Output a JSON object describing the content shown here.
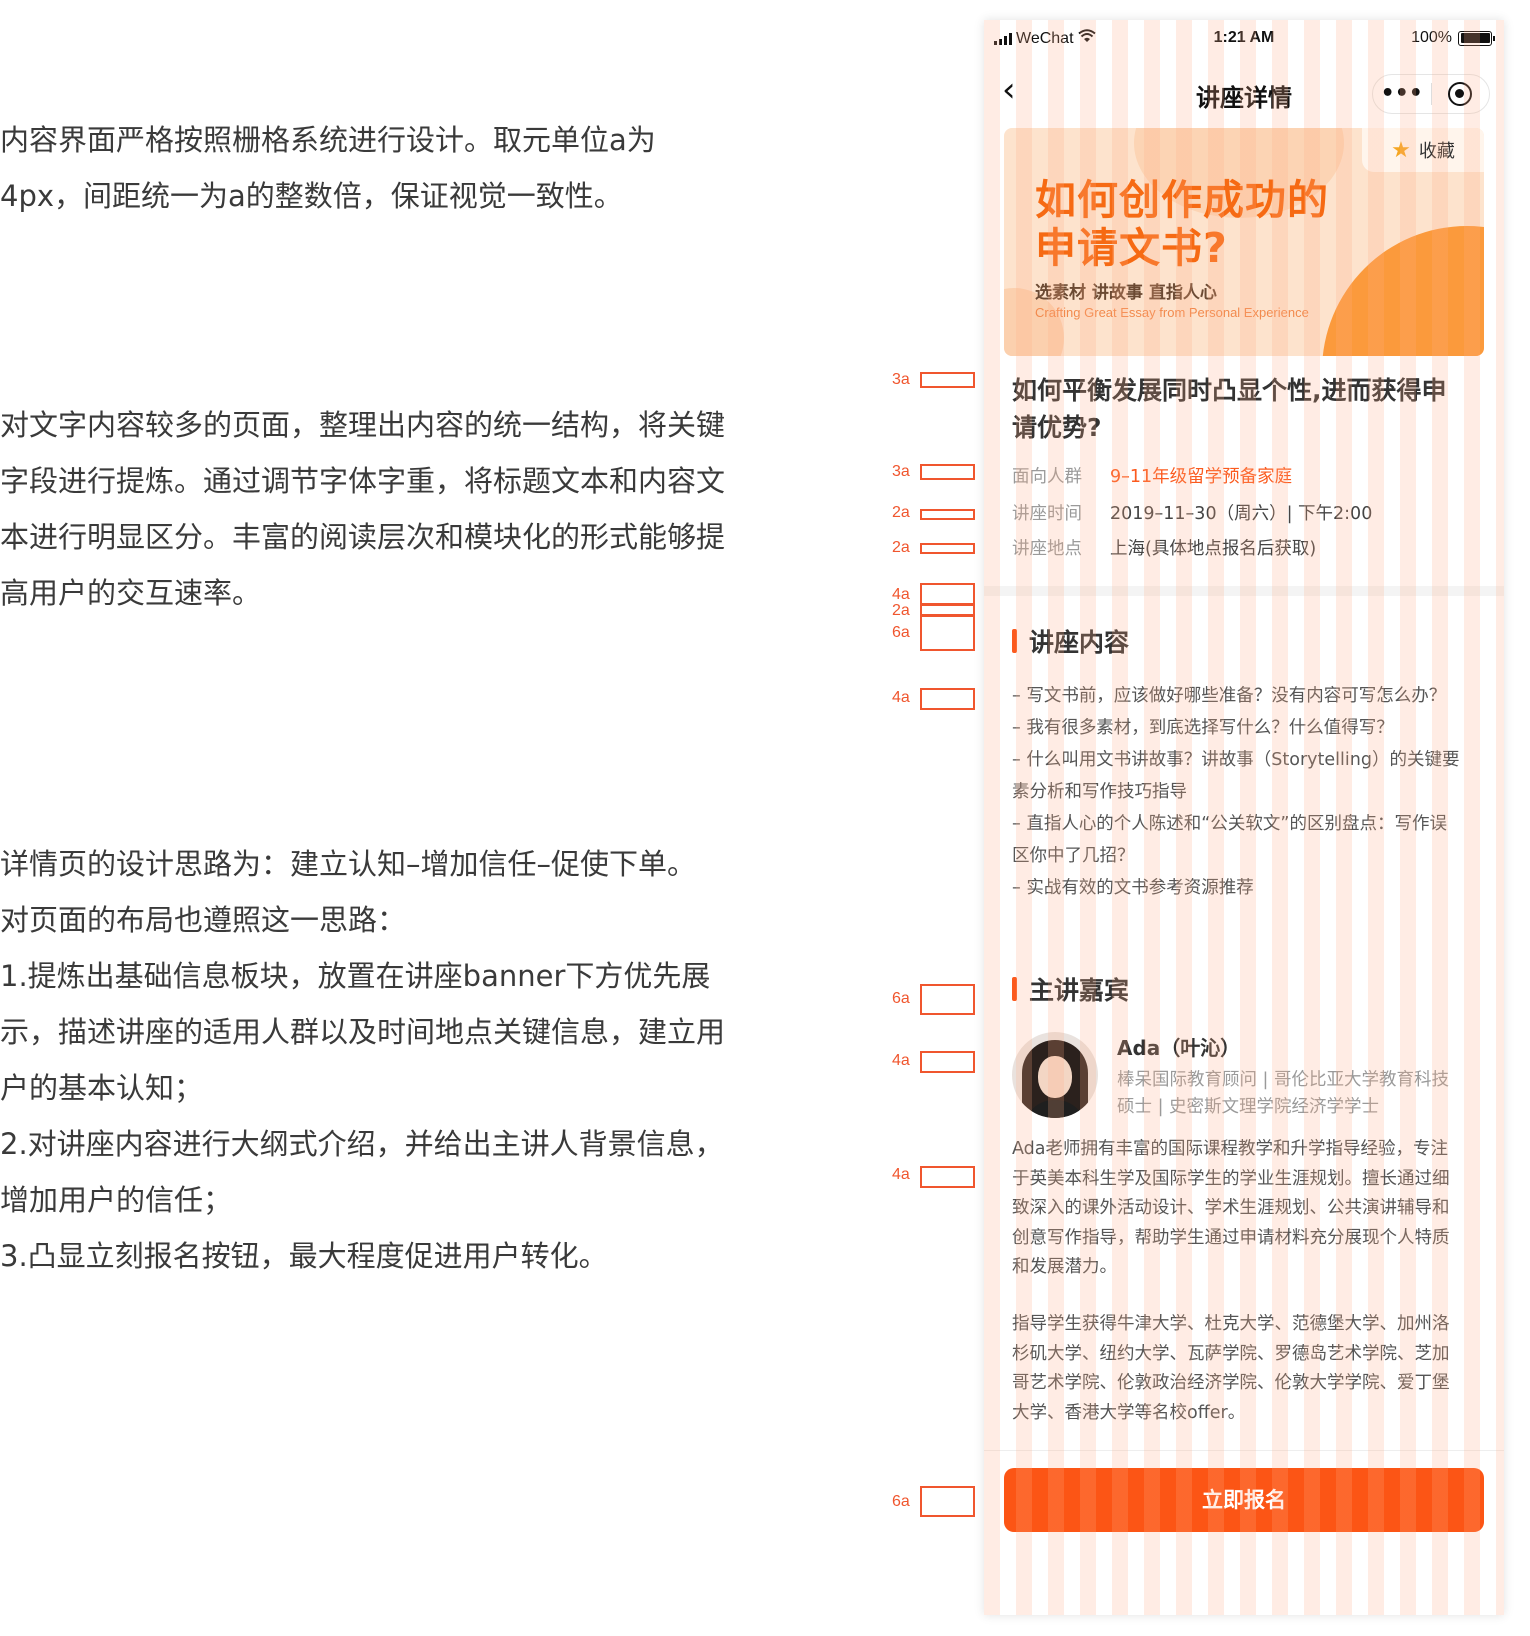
{
  "explanation": {
    "p1": [
      "内容界面严格按照栅格系统进行设计。取元单位a为",
      "4px，间距统一为a的整数倍，保证视觉一致性。"
    ],
    "p2": [
      "对文字内容较多的页面，整理出内容的统一结构，将关键",
      "字段进行提炼。通过调节字体字重，将标题文本和内容文",
      "本进行明显区分。丰富的阅读层次和模块化的形式能够提",
      "高用户的交互速率。"
    ],
    "p3": [
      "详情页的设计思路为：建立认知–增加信任–促使下单。",
      "对页面的布局也遵照这一思路：",
      "1.提炼出基础信息板块，放置在讲座banner下方优先展",
      "示，描述讲座的适用人群以及时间地点关键信息，建立用",
      "户的基本认知；",
      "2.对讲座内容进行大纲式介绍，并给出主讲人背景信息，",
      "增加用户的信任；",
      "3.凸显立刻报名按钮，最大程度促进用户转化。"
    ]
  },
  "annotations": [
    "3a",
    "3a",
    "2a",
    "2a",
    "4a",
    "2a",
    "6a",
    "4a",
    "6a",
    "4a",
    "4a",
    "6a"
  ],
  "status_bar": {
    "carrier": "WeChat",
    "time": "1:21 AM",
    "battery": "100%"
  },
  "nav": {
    "back_icon": "chevron-left-icon",
    "title": "讲座详情",
    "more": "•••"
  },
  "banner": {
    "title_line1": "如何创作成功的",
    "title_line2": "申请文书?",
    "subtitle": "选素材 讲故事 直指人心",
    "english": "Crafting Great Essay from Personal Experience",
    "favorite_label": "收藏"
  },
  "lecture": {
    "title": "如何平衡发展同时凸显个性,进而获得申请优势?",
    "info": [
      {
        "label": "面向人群",
        "value": "9–11年级留学预备家庭"
      },
      {
        "label": "讲座时间",
        "value": "2019–11–30（周六）| 下午2:00"
      },
      {
        "label": "讲座地点",
        "value": "上海(具体地点报名后获取)"
      }
    ]
  },
  "content_section": {
    "heading": "讲座内容",
    "items": [
      "– 写文书前，应该做好哪些准备？没有内容可写怎么办？",
      "– 我有很多素材，到底选择写什么？什么值得写？",
      "– 什么叫用文书讲故事？讲故事（Storytelling）的关键要素分析和写作技巧指导",
      "– 直指人心的个人陈述和“公关软文”的区别盘点：写作误区你中了几招？",
      "– 实战有效的文书参考资源推荐"
    ]
  },
  "speaker_section": {
    "heading": "主讲嘉宾",
    "name": "Ada（叶沁）",
    "title": "棒呆国际教育顾问 | 哥伦比亚大学教育科技硕士 | 史密斯文理学院经济学学士",
    "bio1": "Ada老师拥有丰富的国际课程教学和升学指导经验，专注于英美本科生学及国际学生的学业生涯规划。擅长通过细致深入的课外活动设计、学术生涯规划、公共演讲辅导和创意写作指导，帮助学生通过申请材料充分展现个人特质和发展潜力。",
    "bio2": "指导学生获得牛津大学、杜克大学、范德堡大学、加州洛杉矶大学、纽约大学、瓦萨学院、罗德岛艺术学院、芝加哥艺术学院、伦敦政治经济学院、伦敦大学学院、爱丁堡大学、香港大学等名校offer。"
  },
  "cta": {
    "label": "立即报名"
  },
  "colors": {
    "accent": "#fc5515",
    "highlight": "#fb5a1e",
    "banner_title": "#f66a13",
    "annotation": "#f0562e"
  }
}
